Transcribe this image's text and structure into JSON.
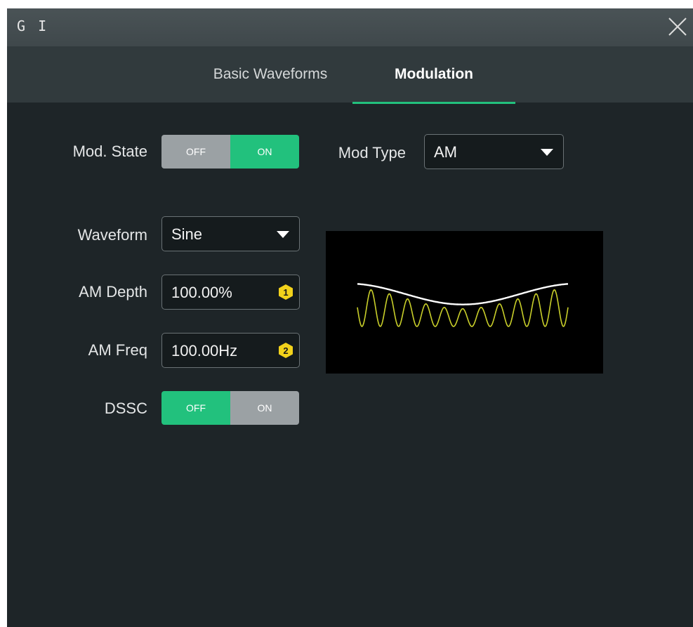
{
  "window": {
    "title": "G I"
  },
  "tabs": [
    {
      "label": "Basic Waveforms",
      "active": false
    },
    {
      "label": "Modulation",
      "active": true
    }
  ],
  "colors": {
    "accent": "#22c17d",
    "background": "#1e2528",
    "toggle_inactive": "#9ba1a4",
    "badge": "#f2d21b"
  },
  "mod_state": {
    "label": "Mod. State",
    "off_label": "OFF",
    "on_label": "ON",
    "value": "ON"
  },
  "mod_type": {
    "label": "Mod Type",
    "value": "AM"
  },
  "waveform": {
    "label": "Waveform",
    "value": "Sine"
  },
  "am_depth": {
    "label": "AM Depth",
    "value": "100.00%",
    "badge": "1"
  },
  "am_freq": {
    "label": "AM Freq",
    "value": "100.00Hz",
    "badge": "2"
  },
  "dssc": {
    "label": "DSSC",
    "off_label": "OFF",
    "on_label": "ON",
    "value": "OFF"
  },
  "icons": {
    "close": "close-icon",
    "dropdown": "caret-down-icon",
    "badge": "hexagon-number-icon"
  }
}
